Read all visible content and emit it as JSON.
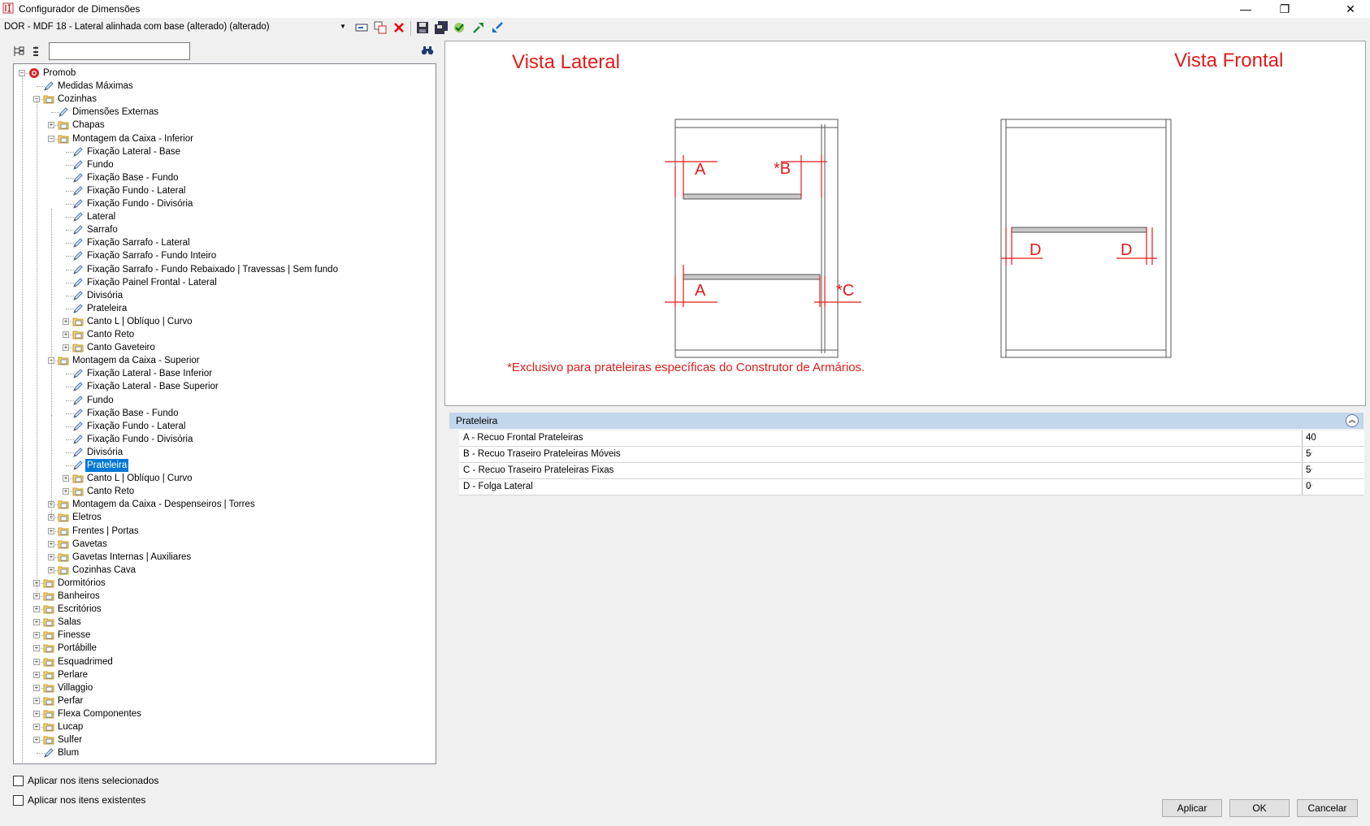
{
  "window": {
    "title": "Configurador de Dimensões",
    "minimize": "—",
    "restore": "❐",
    "close": "✕"
  },
  "toolbar": {
    "config_value": "DOR - MDF 18 - Lateral alinhada com base (alterado) (alterado)",
    "icons": [
      "rename-icon",
      "copy-icon",
      "delete-icon",
      "save-icon",
      "save-all-icon",
      "check-icon",
      "expand-icon",
      "collapse-icon"
    ]
  },
  "search": {
    "value": ""
  },
  "tree": [
    {
      "label": "Promob",
      "level": 0,
      "icon": "promob-icon",
      "exp": "-"
    },
    {
      "label": "Medidas Máximas",
      "level": 1,
      "icon": "pencil-icon",
      "exp": ""
    },
    {
      "label": "Cozinhas",
      "level": 1,
      "icon": "folder-icon",
      "exp": "-"
    },
    {
      "label": "Dimensões Externas",
      "level": 2,
      "icon": "pencil-icon",
      "exp": ""
    },
    {
      "label": "Chapas",
      "level": 2,
      "icon": "folder-icon",
      "exp": "+"
    },
    {
      "label": "Montagem da Caixa - Inferior",
      "level": 2,
      "icon": "folder-icon",
      "exp": "-"
    },
    {
      "label": "Fixação Lateral - Base",
      "level": 3,
      "icon": "pencil-icon",
      "exp": ""
    },
    {
      "label": "Fundo",
      "level": 3,
      "icon": "pencil-icon",
      "exp": ""
    },
    {
      "label": "Fixação Base - Fundo",
      "level": 3,
      "icon": "pencil-icon",
      "exp": ""
    },
    {
      "label": "Fixação Fundo - Lateral",
      "level": 3,
      "icon": "pencil-icon",
      "exp": ""
    },
    {
      "label": "Fixação Fundo - Divisória",
      "level": 3,
      "icon": "pencil-icon",
      "exp": ""
    },
    {
      "label": "Lateral",
      "level": 3,
      "icon": "pencil-icon",
      "exp": ""
    },
    {
      "label": "Sarrafo",
      "level": 3,
      "icon": "pencil-icon",
      "exp": ""
    },
    {
      "label": "Fixação Sarrafo - Lateral",
      "level": 3,
      "icon": "pencil-icon",
      "exp": ""
    },
    {
      "label": "Fixação Sarrafo - Fundo Inteiro",
      "level": 3,
      "icon": "pencil-icon",
      "exp": ""
    },
    {
      "label": "Fixação Sarrafo - Fundo Rebaixado | Travessas | Sem fundo",
      "level": 3,
      "icon": "pencil-icon",
      "exp": ""
    },
    {
      "label": "Fixação Painel Frontal - Lateral",
      "level": 3,
      "icon": "pencil-icon",
      "exp": ""
    },
    {
      "label": "Divisória",
      "level": 3,
      "icon": "pencil-icon",
      "exp": ""
    },
    {
      "label": "Prateleira",
      "level": 3,
      "icon": "pencil-icon",
      "exp": ""
    },
    {
      "label": "Canto L | Oblíquo | Curvo",
      "level": 3,
      "icon": "folder-icon",
      "exp": "+"
    },
    {
      "label": "Canto Reto",
      "level": 3,
      "icon": "folder-icon",
      "exp": "+"
    },
    {
      "label": "Canto Gaveteiro",
      "level": 3,
      "icon": "folder-icon",
      "exp": "+"
    },
    {
      "label": "Montagem da Caixa - Superior",
      "level": 2,
      "icon": "folder-icon",
      "exp": "-"
    },
    {
      "label": "Fixação Lateral - Base Inferior",
      "level": 3,
      "icon": "pencil-icon",
      "exp": ""
    },
    {
      "label": "Fixação Lateral - Base Superior",
      "level": 3,
      "icon": "pencil-icon",
      "exp": ""
    },
    {
      "label": "Fundo",
      "level": 3,
      "icon": "pencil-icon",
      "exp": ""
    },
    {
      "label": "Fixação Base - Fundo",
      "level": 3,
      "icon": "pencil-icon",
      "exp": ""
    },
    {
      "label": "Fixação Fundo - Lateral",
      "level": 3,
      "icon": "pencil-icon",
      "exp": ""
    },
    {
      "label": "Fixação Fundo - Divisória",
      "level": 3,
      "icon": "pencil-icon",
      "exp": ""
    },
    {
      "label": "Divisória",
      "level": 3,
      "icon": "pencil-icon",
      "exp": ""
    },
    {
      "label": "Prateleira",
      "level": 3,
      "icon": "pencil-icon",
      "exp": "",
      "selected": true
    },
    {
      "label": "Canto L | Oblíquo | Curvo",
      "level": 3,
      "icon": "folder-icon",
      "exp": "+"
    },
    {
      "label": "Canto Reto",
      "level": 3,
      "icon": "folder-icon",
      "exp": "+"
    },
    {
      "label": "Montagem da Caixa - Despenseiros | Torres",
      "level": 2,
      "icon": "folder-icon",
      "exp": "+"
    },
    {
      "label": "Eletros",
      "level": 2,
      "icon": "folder-icon",
      "exp": "+"
    },
    {
      "label": "Frentes | Portas",
      "level": 2,
      "icon": "folder-icon",
      "exp": "+"
    },
    {
      "label": "Gavetas",
      "level": 2,
      "icon": "folder-icon",
      "exp": "+"
    },
    {
      "label": "Gavetas Internas | Auxiliares",
      "level": 2,
      "icon": "folder-icon",
      "exp": "+"
    },
    {
      "label": "Cozinhas Cava",
      "level": 2,
      "icon": "folder-icon",
      "exp": "+"
    },
    {
      "label": "Dormitórios",
      "level": 1,
      "icon": "folder-icon",
      "exp": "+"
    },
    {
      "label": "Banheiros",
      "level": 1,
      "icon": "folder-icon",
      "exp": "+"
    },
    {
      "label": "Escritórios",
      "level": 1,
      "icon": "folder-icon",
      "exp": "+"
    },
    {
      "label": "Salas",
      "level": 1,
      "icon": "folder-icon",
      "exp": "+"
    },
    {
      "label": "Finesse",
      "level": 1,
      "icon": "folder-icon",
      "exp": "+"
    },
    {
      "label": "Portábille",
      "level": 1,
      "icon": "folder-icon",
      "exp": "+"
    },
    {
      "label": "Esquadrimed",
      "level": 1,
      "icon": "folder-icon",
      "exp": "+"
    },
    {
      "label": "Perlare",
      "level": 1,
      "icon": "folder-icon",
      "exp": "+"
    },
    {
      "label": "Villaggio",
      "level": 1,
      "icon": "folder-icon",
      "exp": "+"
    },
    {
      "label": "Perfar",
      "level": 1,
      "icon": "folder-icon",
      "exp": "+"
    },
    {
      "label": "Flexa Componentes",
      "level": 1,
      "icon": "folder-icon",
      "exp": "+"
    },
    {
      "label": "Lucap",
      "level": 1,
      "icon": "folder-icon",
      "exp": "+"
    },
    {
      "label": "Sulfer",
      "level": 1,
      "icon": "folder-icon",
      "exp": "+"
    },
    {
      "label": "Blum",
      "level": 1,
      "icon": "pencil-icon",
      "exp": ""
    }
  ],
  "options": {
    "apply_selected": "Aplicar nos itens selecionados",
    "apply_existing": "Aplicar nos itens existentes"
  },
  "drawing": {
    "lateral_title": "Vista Lateral",
    "frontal_title": "Vista Frontal",
    "label_a": "A",
    "label_b": "*B",
    "label_c": "*C",
    "label_d": "D",
    "note": "*Exclusivo para prateleiras específicas do Construtor de Armários.",
    "accent_color": "#e31b1b"
  },
  "properties": {
    "header": "Prateleira",
    "rows": [
      {
        "label": "A - Recuo Frontal Prateleiras",
        "value": "40"
      },
      {
        "label": "B - Recuo Traseiro Prateleiras Móveis",
        "value": "5"
      },
      {
        "label": "C - Recuo Traseiro Prateleiras Fixas",
        "value": "5"
      },
      {
        "label": "D - Folga Lateral",
        "value": "0"
      }
    ]
  },
  "buttons": {
    "apply": "Aplicar",
    "ok": "OK",
    "cancel": "Cancelar"
  }
}
